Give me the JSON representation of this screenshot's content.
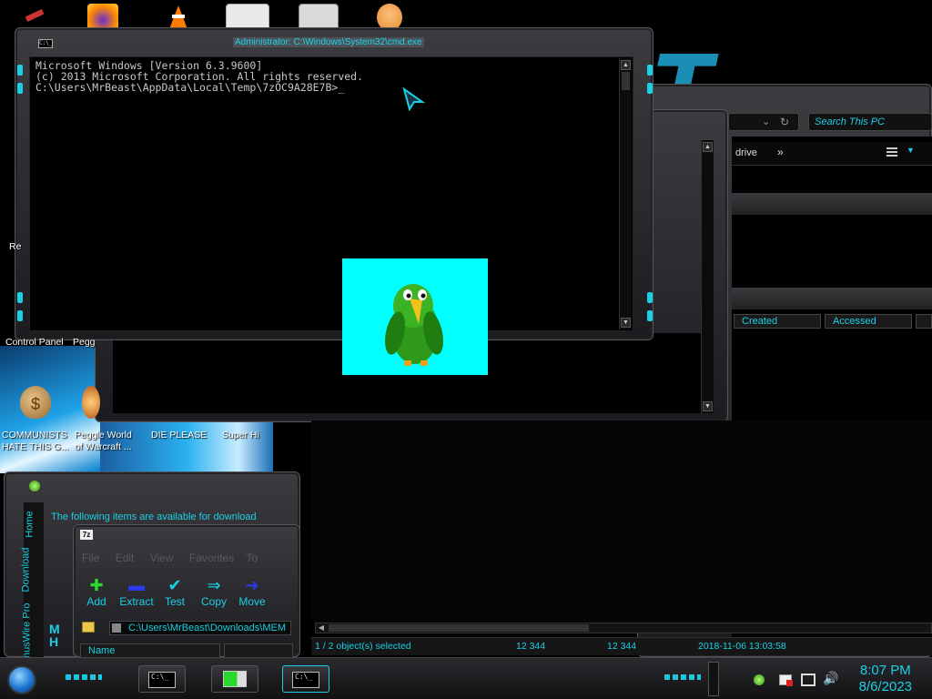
{
  "colors": {
    "accent": "#19d1e6",
    "bird_bg": "#00ffff"
  },
  "top_icons": [
    {
      "name": "firefox-icon"
    },
    {
      "name": "vlc-icon"
    },
    {
      "name": "app-icon"
    },
    {
      "name": "network-app-icon"
    },
    {
      "name": "user-icon"
    }
  ],
  "cmd": {
    "title": "Administrator: C:\\Windows\\System32\\cmd.exe",
    "titlebar_icon": "C:\\_",
    "lines": [
      "Microsoft Windows [Version 6.3.9600]",
      "(c) 2013 Microsoft Corporation. All rights reserved.",
      "",
      "C:\\Users\\MrBeast\\AppData\\Local\\Temp\\7zOC9A28E7B>_"
    ]
  },
  "explorer": {
    "search_placeholder": "Search This PC",
    "drive_label": "drive",
    "nav_more": "»",
    "columns": [
      "Created",
      "Accessed"
    ],
    "status": {
      "selected": "1 / 2 object(s) selected",
      "size1": "12 344",
      "size2": "12 344",
      "date": "2018-11-06 13:03:58"
    }
  },
  "desktop": {
    "labels": {
      "recycle": "Re",
      "control_panel": "Control Panel",
      "peggle_top": "Pegg",
      "communists": "COMMUNISTS\nHATE THIS G...",
      "peggle_world": "Peggle World\nof Warcraft ...",
      "die_please": "DIE PLEASE",
      "super_hi": "Super Hi"
    }
  },
  "download_window": {
    "text": "The following items are available for download",
    "tabs": [
      "Home",
      "Download",
      "inusWire Pro"
    ]
  },
  "sevenzip": {
    "title_icon": "7z",
    "menu": [
      "File",
      "Edit",
      "View",
      "Favorites",
      "To"
    ],
    "toolbar": [
      "Add",
      "Extract",
      "Test",
      "Copy",
      "Move"
    ],
    "path": "C:\\Users\\MrBeast\\Downloads\\MEM",
    "column_name": "Name"
  },
  "taskbar": {
    "cmd_icon": "C:\\_",
    "time": "8:07 PM",
    "date": "8/6/2023"
  }
}
